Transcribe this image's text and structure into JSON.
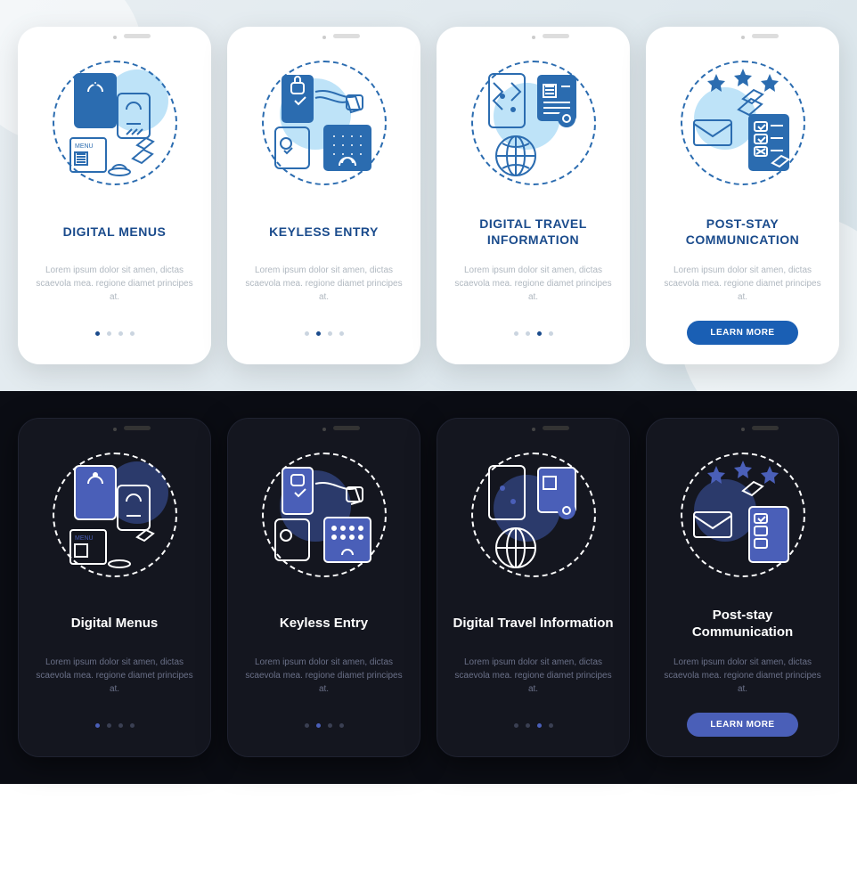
{
  "lorem": "Lorem ipsum dolor sit amen, dictas scaevola mea. regione diamet principes at.",
  "button_label": "LEARN MORE",
  "light": {
    "screens": [
      {
        "title": "DIGITAL MENUS"
      },
      {
        "title": "KEYLESS ENTRY"
      },
      {
        "title": "DIGITAL TRAVEL INFORMATION"
      },
      {
        "title": "POST-STAY COMMUNICATION"
      }
    ]
  },
  "dark": {
    "screens": [
      {
        "title": "Digital Menus"
      },
      {
        "title": "Keyless Entry"
      },
      {
        "title": "Digital Travel Information"
      },
      {
        "title": "Post-stay Communication"
      }
    ]
  }
}
